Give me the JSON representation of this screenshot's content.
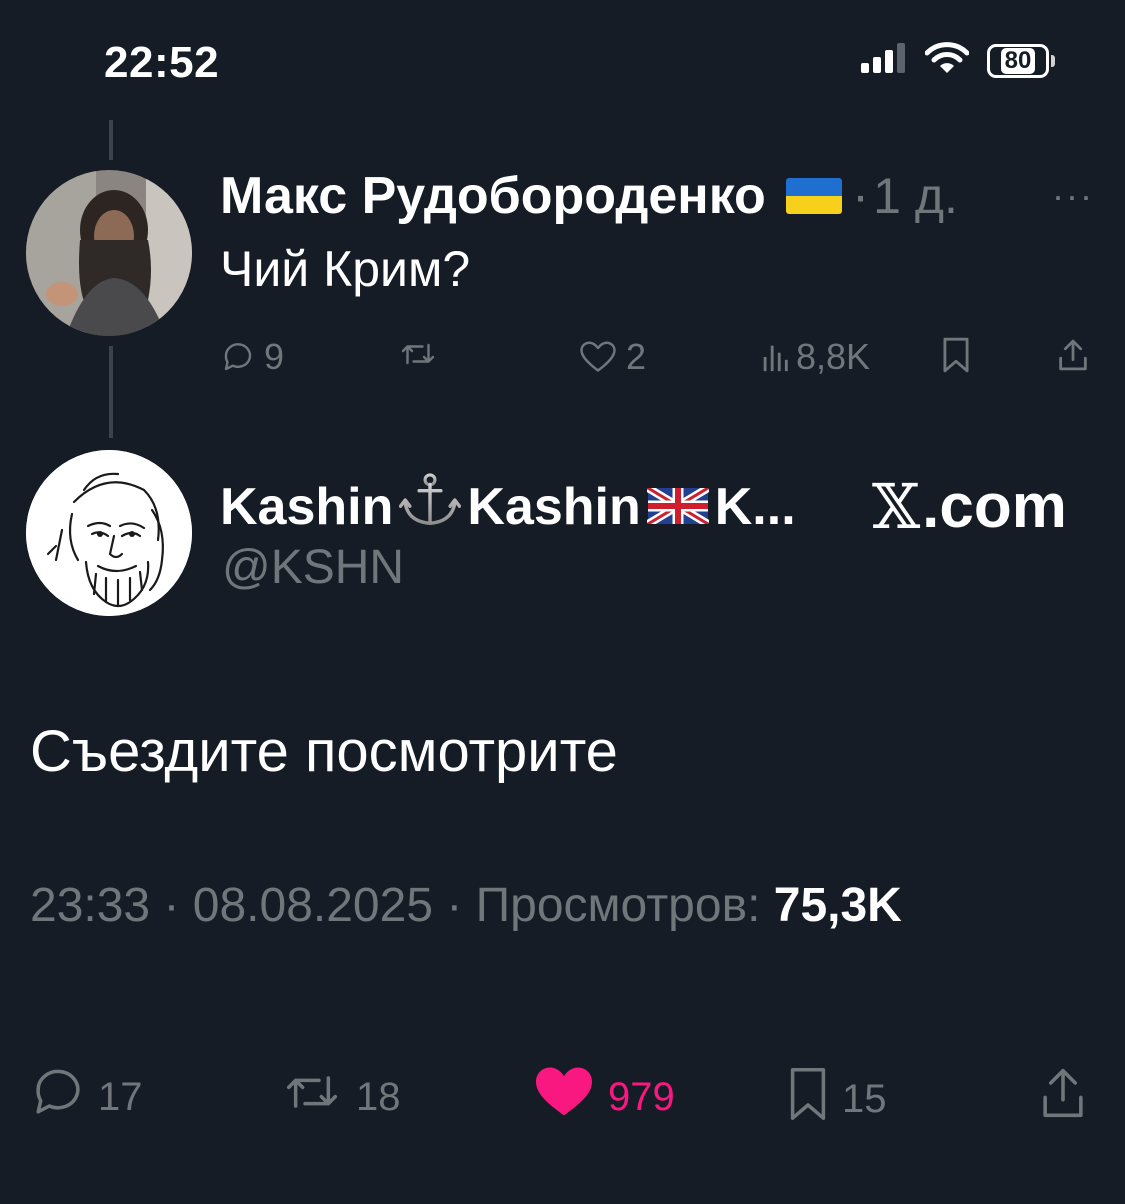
{
  "status_bar": {
    "time": "22:52",
    "battery": "80",
    "icons": [
      "signal-icon",
      "wifi-icon",
      "battery-icon"
    ]
  },
  "parent_tweet": {
    "author_name": "Макс Рудобороденко",
    "flag": "ukraine-flag-icon",
    "separator": "·",
    "age": "1 д.",
    "more": "···",
    "text": "Чий Крим?",
    "actions": {
      "replies": "9",
      "retweets": "",
      "likes": "2",
      "views": "8,8K"
    }
  },
  "main_tweet": {
    "name_part1": "Kashin",
    "name_part2": "Kashin",
    "name_part3": "K...",
    "handle": "@KSHN",
    "watermark_x": "𝕏",
    "watermark_domain": ".com",
    "text": "Съездите посмотрите",
    "timestamp": "23:33 · 08.08.2025 · Просмотров:",
    "views": "75,3K",
    "actions": {
      "replies": "17",
      "retweets": "18",
      "likes": "979",
      "bookmarks": "15"
    }
  },
  "colors": {
    "background": "#151c26",
    "text": "#ffffff",
    "muted": "#71767b",
    "like": "#f91880"
  }
}
